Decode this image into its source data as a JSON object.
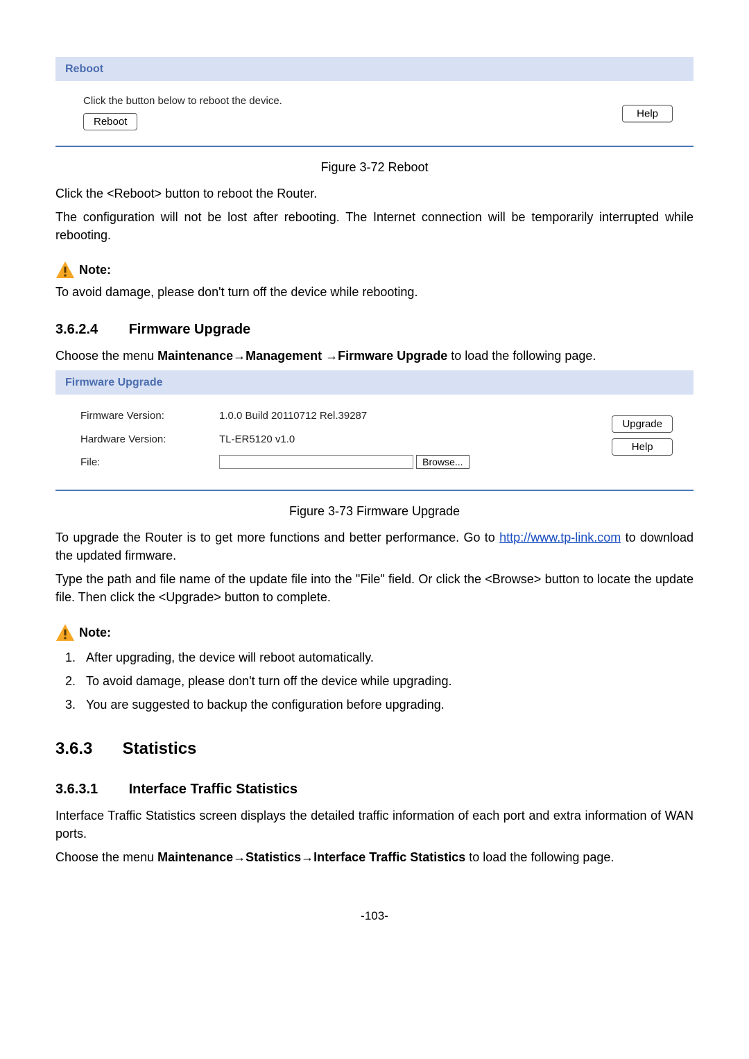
{
  "reboot_panel": {
    "title": "Reboot",
    "instruction": "Click the button below to reboot the device.",
    "reboot_button": "Reboot",
    "help_button": "Help"
  },
  "figure_reboot_caption": "Figure 3-72 Reboot",
  "reboot_text1": "Click the <Reboot> button to reboot the Router.",
  "reboot_text2": "The configuration will not be lost after rebooting. The Internet connection will be temporarily interrupted while rebooting.",
  "note_label": "Note:",
  "reboot_note": "To avoid damage, please don't turn off the device while rebooting.",
  "fw_heading_num": "3.6.2.4",
  "fw_heading_title": "Firmware Upgrade",
  "fw_menu_prefix": "Choose the menu ",
  "fw_menu_path_a": "Maintenance",
  "fw_menu_path_b": "Management ",
  "fw_menu_path_c": "Firmware Upgrade",
  "fw_menu_suffix": " to load the following page.",
  "arrow": "→",
  "fw_panel": {
    "title": "Firmware Upgrade",
    "fw_version_label": "Firmware Version:",
    "fw_version_value": "1.0.0 Build 20110712 Rel.39287",
    "hw_version_label": "Hardware Version:",
    "hw_version_value": "TL-ER5120 v1.0",
    "file_label": "File:",
    "browse_button": "Browse...",
    "upgrade_button": "Upgrade",
    "help_button": "Help"
  },
  "figure_fw_caption": "Figure 3-73 Firmware Upgrade",
  "fw_text1_a": "To upgrade the Router is to get more functions and better performance. Go to ",
  "fw_link": "http://www.tp-link.com",
  "fw_text1_b": " to download the updated firmware.",
  "fw_text2": "Type the path and file name of the update file into the \"File\" field. Or click the <Browse> button to locate the update file. Then click the <Upgrade> button to complete.",
  "fw_notes": [
    "After upgrading, the device will reboot automatically.",
    "To avoid damage, please don't turn off the device while upgrading.",
    "You are suggested to backup the configuration before upgrading."
  ],
  "stats_heading_num": "3.6.3",
  "stats_heading_title": "Statistics",
  "its_heading_num": "3.6.3.1",
  "its_heading_title": "Interface Traffic Statistics",
  "its_text1": "Interface Traffic Statistics screen displays the detailed traffic information of each port and extra information of WAN ports.",
  "its_menu_prefix": "Choose the menu ",
  "its_menu_path_a": "Maintenance",
  "its_menu_path_b": "Statistics",
  "its_menu_path_c": "Interface Traffic Statistics",
  "its_menu_suffix": " to load the following page.",
  "page_number": "-103-"
}
